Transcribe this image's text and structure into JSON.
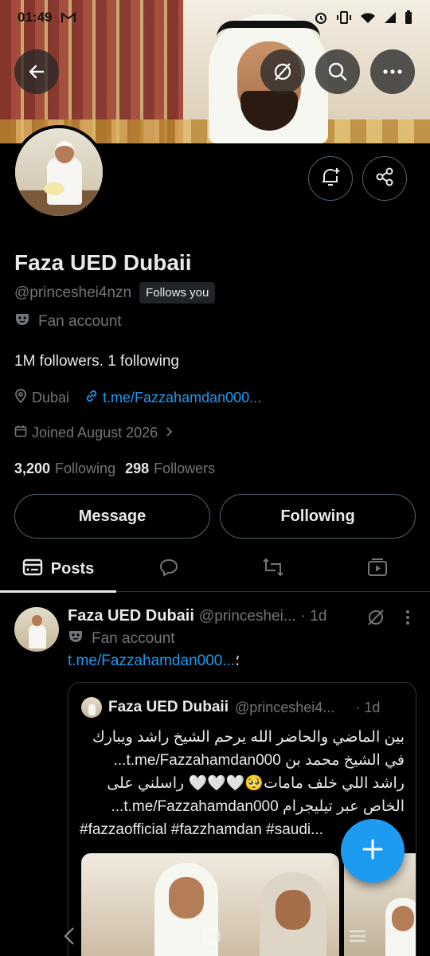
{
  "status_bar": {
    "time": "01:49"
  },
  "profile": {
    "name": "Faza UED Dubaii",
    "handle": "@princeshei4nzn",
    "follows_you": "Follows you",
    "category": "Fan account",
    "bio": "1M followers. 1 following",
    "location": "Dubai",
    "link": "t.me/Fazzahamdan000...",
    "joined": "Joined August 2026",
    "following_count": "3,200",
    "following_label": "Following",
    "followers_count": "298",
    "followers_label": "Followers"
  },
  "actions": {
    "message": "Message",
    "following": "Following"
  },
  "tabs": {
    "posts": "Posts"
  },
  "post": {
    "name": "Faza UED Dubaii",
    "handle": "@princeshei...",
    "time": "· 1d",
    "category": "Fan account",
    "link": "t.me/Fazzahamdan000...",
    "link_suffix": "؛",
    "quote": {
      "name": "Faza UED Dubaii",
      "handle": "@princeshei4...",
      "time": "· 1d",
      "text_line1": "بين الماضي والحاضر الله يرحم الشيخ راشد  ويبارك",
      "text_line2": "في الشيخ محمد بن t.me/Fazzahamdan000...",
      "text_line3": "راشد اللي خلف مامات🥺🤍🤍🤍 راسلني على",
      "text_line4": "الخاص عبر تيليجرام t.me/Fazzahamdan000...",
      "text_line5": "#fazzaofficial #fazzhamdan #saudi..."
    }
  },
  "colors": {
    "background": "#000000",
    "text_primary": "#e7e9ea",
    "text_secondary": "#71767b",
    "link": "#1d9bf0",
    "fab": "#1d9bf0",
    "border": "#2f3336"
  }
}
